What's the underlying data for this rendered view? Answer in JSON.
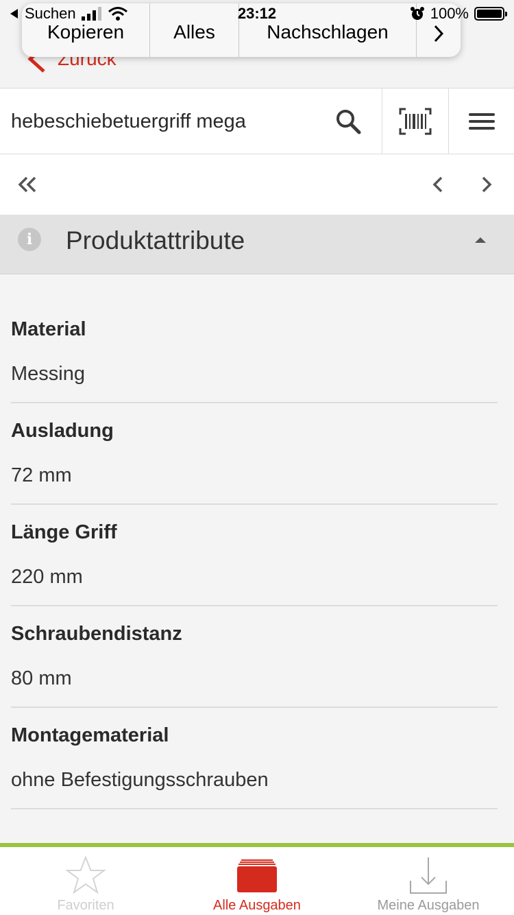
{
  "status_bar": {
    "back_app": "Suchen",
    "time": "23:12",
    "battery": "100%",
    "battery_level": 1.0
  },
  "popup_menu": {
    "items": [
      "Kopieren",
      "Alles",
      "Nachschlagen"
    ],
    "more_icon": "chevron-right-icon"
  },
  "nav": {
    "back_label": "Zurück",
    "back_icon": "chevron-left-icon"
  },
  "search": {
    "value": "hebeschiebetuergriff mega",
    "search_icon": "magnifier-icon",
    "barcode_icon": "barcode-scan-icon",
    "menu_icon": "hamburger-menu-icon"
  },
  "pager": {
    "first_icon": "double-chevron-left-icon",
    "prev_icon": "chevron-left-icon",
    "next_icon": "chevron-right-icon"
  },
  "section": {
    "title": "Produktattribute",
    "icon": "info-icon",
    "info_glyph": "i",
    "collapse_icon": "caret-up-icon"
  },
  "attributes": [
    {
      "label": "Material",
      "value": "Messing"
    },
    {
      "label": "Ausladung",
      "value": "72 mm"
    },
    {
      "label": "Länge Griff",
      "value": "220 mm"
    },
    {
      "label": "Schraubendistanz",
      "value": "80 mm"
    },
    {
      "label": "Montagematerial",
      "value": "ohne Befestigungsschrauben"
    }
  ],
  "tabs": [
    {
      "label": "Favoriten",
      "icon": "star-icon",
      "active": false
    },
    {
      "label": "Alle Ausgaben",
      "icon": "stack-icon",
      "active": true
    },
    {
      "label": "Meine Ausgaben",
      "icon": "download-tray-icon",
      "active": false
    }
  ],
  "colors": {
    "accent": "#d52b1e",
    "tab_border": "#9bc341",
    "section_bg": "#e2e2e2",
    "content_bg": "#f4f4f4"
  }
}
